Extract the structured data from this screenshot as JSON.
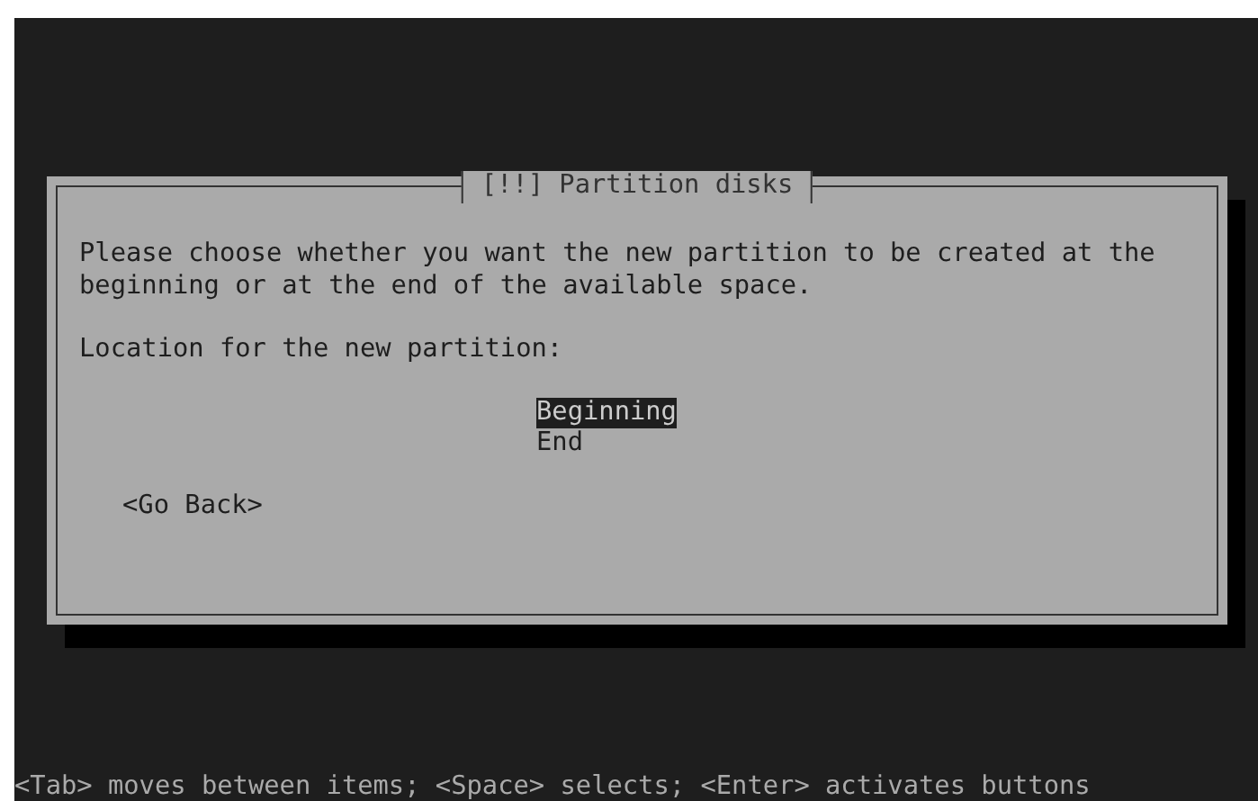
{
  "dialog": {
    "title": "[!!] Partition disks",
    "message": "Please choose whether you want the new partition to be created at the\nbeginning or at the end of the available space.",
    "prompt": "Location for the new partition:",
    "options": [
      {
        "label": "Beginning",
        "selected": true
      },
      {
        "label": "End",
        "selected": false
      }
    ],
    "back_button": "<Go Back>"
  },
  "help_line": "<Tab> moves between items; <Space> selects; <Enter> activates buttons"
}
